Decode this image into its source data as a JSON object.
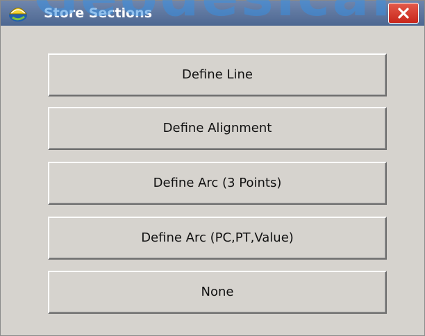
{
  "window": {
    "title": "Store Sections",
    "watermark": "Geodesical",
    "icons": {
      "app": "survey-helmet-icon",
      "close": "close-icon"
    },
    "colors": {
      "titlebar": "#5a729b",
      "close_button": "#d33a2c",
      "dialog_background": "#d6d3ce",
      "watermark": "#3a8fe0"
    }
  },
  "buttons": [
    {
      "label": "Define Line"
    },
    {
      "label": "Define Alignment"
    },
    {
      "label": "Define Arc (3 Points)"
    },
    {
      "label": "Define Arc (PC,PT,Value)"
    },
    {
      "label": "None"
    }
  ]
}
